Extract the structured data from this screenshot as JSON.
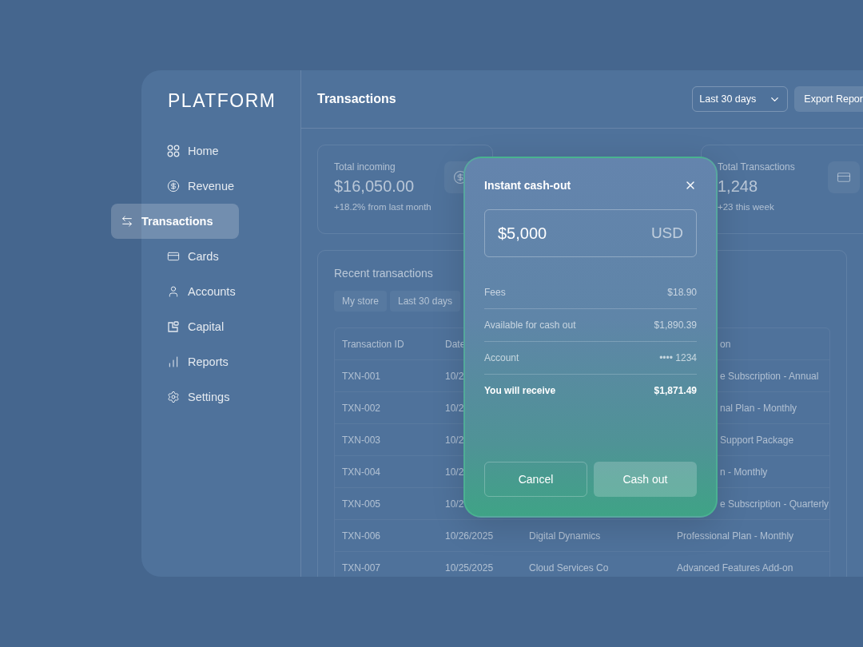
{
  "sidebar": {
    "logo": "PLATFORM",
    "items": [
      {
        "label": "Home",
        "selected": false
      },
      {
        "label": "Revenue",
        "selected": false
      },
      {
        "label": "Transactions",
        "selected": true
      },
      {
        "label": "Cards",
        "selected": false
      },
      {
        "label": "Accounts",
        "selected": false
      },
      {
        "label": "Capital",
        "selected": false
      },
      {
        "label": "Reports",
        "selected": false
      },
      {
        "label": "Settings",
        "selected": false
      }
    ]
  },
  "header": {
    "title": "Transactions",
    "period_select": "Last 30 days",
    "export_button": "Export Repor"
  },
  "stats": [
    {
      "label": "Total incoming",
      "value": "$16,050.00",
      "change": "+18.2% from last month"
    },
    {
      "label": "Total Transactions",
      "value": "1,248",
      "change": "+23 this week"
    }
  ],
  "recent": {
    "title": "Recent transactions",
    "filters": [
      "My store",
      "Last 30 days"
    ],
    "columns": [
      "Transaction ID",
      "Date",
      "",
      "on"
    ],
    "rows": [
      {
        "id": "TXN-001",
        "date": "10/2",
        "customer": "",
        "description": "e Subscription - Annual"
      },
      {
        "id": "TXN-002",
        "date": "10/2",
        "customer": "",
        "description": "nal Plan - Monthly"
      },
      {
        "id": "TXN-003",
        "date": "10/2",
        "customer": "",
        "description": "Support Package"
      },
      {
        "id": "TXN-004",
        "date": "10/2",
        "customer": "",
        "description": "n - Monthly"
      },
      {
        "id": "TXN-005",
        "date": "10/2",
        "customer": "",
        "description": "e Subscription - Quarterly"
      },
      {
        "id": "TXN-006",
        "date": "10/26/2025",
        "customer": "Digital Dynamics",
        "description": "Professional Plan - Monthly"
      },
      {
        "id": "TXN-007",
        "date": "10/25/2025",
        "customer": "Cloud Services Co",
        "description": "Advanced Features Add-on"
      }
    ]
  },
  "modal": {
    "title": "Instant cash-out",
    "amount": "$5,000",
    "currency": "USD",
    "lines": [
      {
        "label": "Fees",
        "value": "$18.90",
        "emphasis": false
      },
      {
        "label": "Available for cash out",
        "value": "$1,890.39",
        "emphasis": false
      },
      {
        "label": "Account",
        "value": "•••• 1234",
        "emphasis": false
      },
      {
        "label": "You will receive",
        "value": "$1,871.49",
        "emphasis": true
      }
    ],
    "cancel": "Cancel",
    "confirm": "Cash out"
  }
}
